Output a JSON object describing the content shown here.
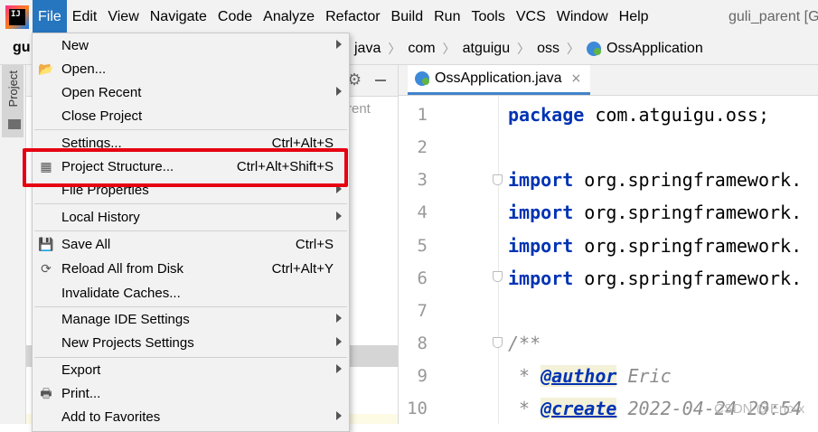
{
  "menubar": {
    "logo_text": "IJ",
    "items": [
      "File",
      "Edit",
      "View",
      "Navigate",
      "Code",
      "Analyze",
      "Refactor",
      "Build",
      "Run",
      "Tools",
      "VCS",
      "Window",
      "Help"
    ],
    "project_title": "guli_parent [G"
  },
  "navbar": {
    "root": "gu",
    "breadcrumb": [
      "java",
      "com",
      "atguigu",
      "oss",
      "OssApplication"
    ]
  },
  "tool_stripe": {
    "project_label": "Project"
  },
  "panel": {
    "peek_text": "rent"
  },
  "editor": {
    "tab_label": "OssApplication.java",
    "tab_close": "×",
    "line_numbers": [
      "1",
      "2",
      "3",
      "4",
      "5",
      "6",
      "7",
      "8",
      "9",
      "10"
    ],
    "lines": [
      {
        "kw": "package",
        "rest": " com.atguigu.oss;"
      },
      {
        "kw": "",
        "rest": ""
      },
      {
        "kw": "import",
        "rest": " org.springframework."
      },
      {
        "kw": "import",
        "rest": " org.springframework."
      },
      {
        "kw": "import",
        "rest": " org.springframework."
      },
      {
        "kw": "import",
        "rest": " org.springframework."
      },
      {
        "kw": "",
        "rest": ""
      },
      {
        "cm": "/**"
      },
      {
        "cm_prefix": " * ",
        "tag": "@author",
        "cm_rest": " Eric"
      },
      {
        "cm_prefix": " * ",
        "tag": "@create",
        "cm_rest": " 2022-04-24 20:54"
      }
    ]
  },
  "watermark": "CSDN @Eric-x",
  "file_menu": {
    "items": [
      {
        "label": "New",
        "shortcut": "",
        "submenu": true,
        "icon": ""
      },
      {
        "label": "Open...",
        "shortcut": "",
        "submenu": false,
        "icon": "folder-open-icon"
      },
      {
        "label": "Open Recent",
        "shortcut": "",
        "submenu": true,
        "icon": ""
      },
      {
        "label": "Close Project",
        "shortcut": "",
        "submenu": false,
        "icon": ""
      },
      {
        "label": "Settings...",
        "shortcut": "Ctrl+Alt+S",
        "submenu": false,
        "icon": ""
      },
      {
        "label": "Project Structure...",
        "shortcut": "Ctrl+Alt+Shift+S",
        "submenu": false,
        "icon": "project-structure-icon"
      },
      {
        "label": "File Properties",
        "shortcut": "",
        "submenu": true,
        "icon": ""
      },
      {
        "label": "Local History",
        "shortcut": "",
        "submenu": true,
        "icon": ""
      },
      {
        "label": "Save All",
        "shortcut": "Ctrl+S",
        "submenu": false,
        "icon": "save-icon"
      },
      {
        "label": "Reload All from Disk",
        "shortcut": "Ctrl+Alt+Y",
        "submenu": false,
        "icon": "reload-icon"
      },
      {
        "label": "Invalidate Caches...",
        "shortcut": "",
        "submenu": false,
        "icon": ""
      },
      {
        "label": "Manage IDE Settings",
        "shortcut": "",
        "submenu": true,
        "icon": ""
      },
      {
        "label": "New Projects Settings",
        "shortcut": "",
        "submenu": true,
        "icon": ""
      },
      {
        "label": "Export",
        "shortcut": "",
        "submenu": true,
        "icon": ""
      },
      {
        "label": "Print...",
        "shortcut": "",
        "submenu": false,
        "icon": "print-icon"
      },
      {
        "label": "Add to Favorites",
        "shortcut": "",
        "submenu": true,
        "icon": ""
      }
    ]
  },
  "colors": {
    "menu_active": "#2675bf",
    "highlight_border": "#e60012",
    "keyword": "#0033b3",
    "comment": "#8c8c8c"
  }
}
